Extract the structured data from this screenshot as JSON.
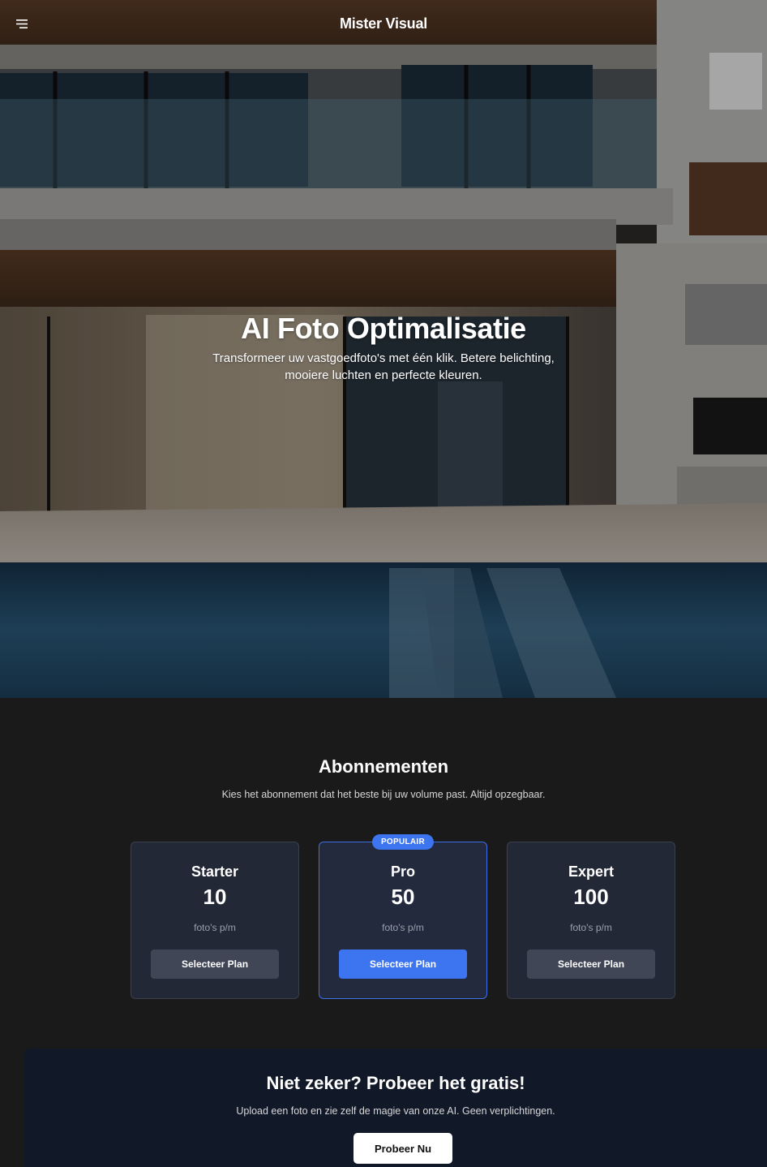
{
  "header": {
    "brand": "Mister Visual",
    "menu_icon": "hamburger-menu-icon"
  },
  "hero": {
    "title": "AI Foto Optimalisatie",
    "subtitle": "Transformeer uw vastgoedfoto's met één klik. Betere belichting, mooiere luchten en perfecte kleuren."
  },
  "pricing": {
    "title": "Abonnementen",
    "subtitle": "Kies het abonnement dat het beste bij uw volume past. Altijd opzegbaar.",
    "plans": [
      {
        "name": "Starter",
        "amount": "10",
        "unit": "foto's p/m",
        "button": "Selecteer Plan",
        "badge": ""
      },
      {
        "name": "Pro",
        "amount": "50",
        "unit": "foto's p/m",
        "button": "Selecteer Plan",
        "badge": "POPULAIR"
      },
      {
        "name": "Expert",
        "amount": "100",
        "unit": "foto's p/m",
        "button": "Selecteer Plan",
        "badge": ""
      }
    ]
  },
  "cta": {
    "title": "Niet zeker? Probeer het gratis!",
    "subtitle": "Upload een foto en zie zelf de magie van onze AI. Geen verplichtingen.",
    "button": "Probeer Nu"
  },
  "colors": {
    "accent": "#3d74f0",
    "page_background": "#1a1a1a",
    "card_background": "#232837",
    "cta_background": "#111828"
  }
}
